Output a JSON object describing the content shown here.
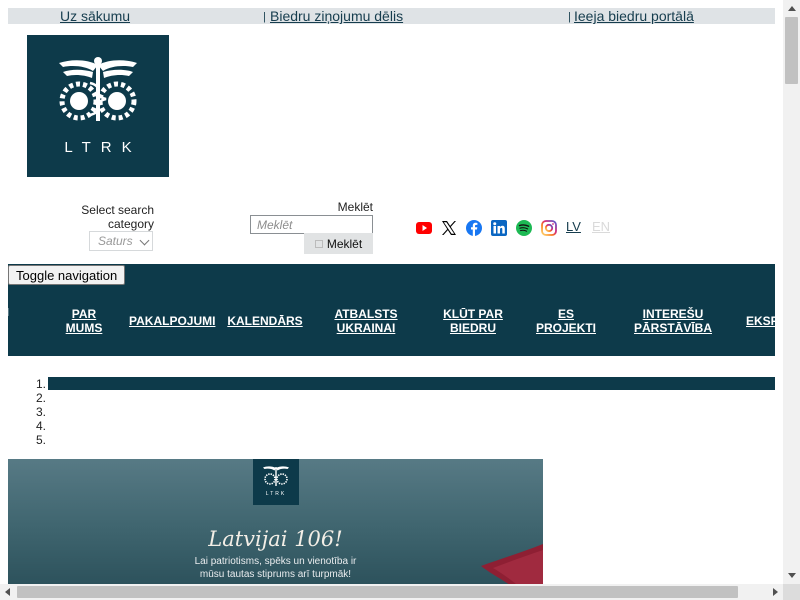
{
  "topbar": {
    "home_label": "Uz sākumu",
    "board_label": "Biedru ziņojumu dēlis",
    "portal_label": "Ieeja biedru portālā",
    "separator": "|"
  },
  "logo": {
    "text": "LTRK"
  },
  "search": {
    "category_label": "Select search category",
    "category_value": "Saturs",
    "label": "Meklēt",
    "placeholder": "Meklēt",
    "button_label": "Meklēt"
  },
  "social": {
    "icons": [
      "youtube-icon",
      "x-icon",
      "facebook-icon",
      "linkedin-icon",
      "spotify-icon",
      "instagram-icon"
    ],
    "colors": {
      "youtube": "#ff0000",
      "x": "#000000",
      "facebook": "#1877f2",
      "linkedin": "#0a66c2",
      "spotify": "#1db954",
      "instagram": "#d62976"
    }
  },
  "languages": {
    "lv": "LV",
    "en": "EN"
  },
  "nav": {
    "toggle_label": "Toggle navigation",
    "items": [
      {
        "line1": "PAR",
        "line2": "MUMS"
      },
      {
        "line1": "PAKALPOJUMI",
        "line2": ""
      },
      {
        "line1": "KALENDĀRS",
        "line2": ""
      },
      {
        "line1": "ATBALSTS",
        "line2": "UKRAINAI"
      },
      {
        "line1": "KLŪT PAR",
        "line2": "BIEDRU"
      },
      {
        "line1": "ES",
        "line2": "PROJEKTI"
      },
      {
        "line1": "INTEREŠU",
        "line2": "PĀRSTĀVĪBA"
      },
      {
        "line1": "EKSP",
        "line2": ""
      }
    ]
  },
  "carousel": {
    "indicators": [
      "1.",
      "2.",
      "3.",
      "4.",
      "5."
    ]
  },
  "banner": {
    "logo_text": "LTRK",
    "title": "Latvijai 106!",
    "subtitle_line1": "Lai patriotisms, spēks un vienotība ir",
    "subtitle_line2": "mūsu tautas stiprums arī turpmāk!"
  },
  "theme": {
    "brand": "#0d3a4a",
    "topbar_bg": "#dfe3e6"
  }
}
